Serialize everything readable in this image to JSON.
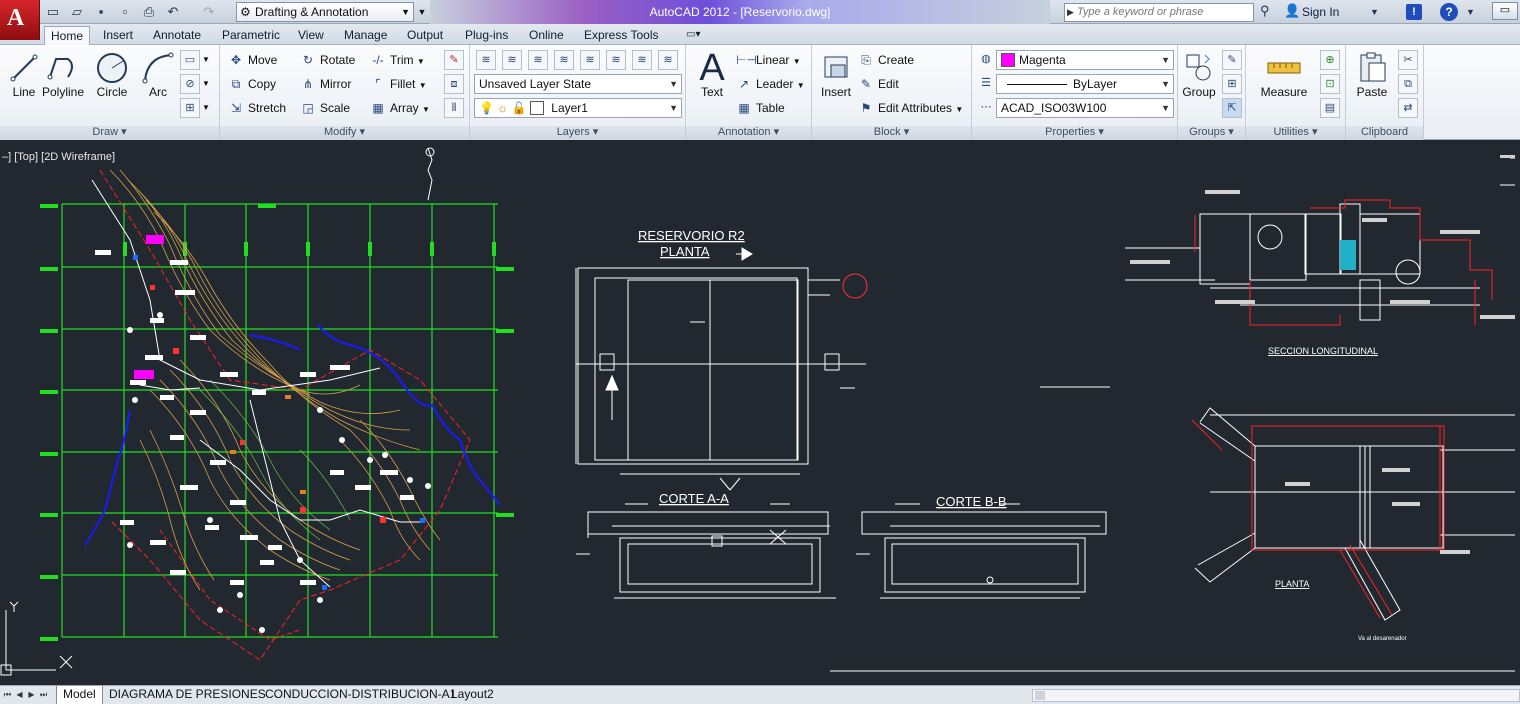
{
  "app": {
    "title": "AutoCAD 2012 - [Reservorio.dwg]",
    "workspace": "Drafting & Annotation",
    "search_placeholder": "Type a keyword or phrase",
    "sign_in": "Sign In"
  },
  "ribbon_tabs": [
    "Home",
    "Insert",
    "Annotate",
    "Parametric",
    "View",
    "Manage",
    "Output",
    "Plug-ins",
    "Online",
    "Express Tools"
  ],
  "panels": {
    "draw": {
      "title": "Draw",
      "line": "Line",
      "polyline": "Polyline",
      "circle": "Circle",
      "arc": "Arc"
    },
    "modify": {
      "title": "Modify",
      "move": "Move",
      "rotate": "Rotate",
      "trim": "Trim",
      "copy": "Copy",
      "mirror": "Mirror",
      "fillet": "Fillet",
      "stretch": "Stretch",
      "scale": "Scale",
      "array": "Array"
    },
    "layers": {
      "title": "Layers",
      "layer_state": "Unsaved Layer State",
      "current_layer": "Layer1"
    },
    "annotation": {
      "title": "Annotation",
      "text": "Text",
      "linear": "Linear",
      "leader": "Leader",
      "table": "Table"
    },
    "block": {
      "title": "Block",
      "insert": "Insert",
      "create": "Create",
      "edit": "Edit",
      "edit_attributes": "Edit Attributes"
    },
    "properties": {
      "title": "Properties",
      "color": "Magenta",
      "color_hex": "#ff00ff",
      "lineweight": "ByLayer",
      "linetype": "ACAD_ISO03W100"
    },
    "groups": {
      "title": "Groups",
      "group": "Group"
    },
    "utilities": {
      "title": "Utilities",
      "measure": "Measure"
    },
    "clipboard": {
      "title": "Clipboard",
      "paste": "Paste"
    }
  },
  "viewport": {
    "label": "–] [Top] [2D Wireframe]"
  },
  "drawing_labels": {
    "reservorio_title": "RESERVORIO R2",
    "planta_title": "PLANTA",
    "corte_aa": "CORTE A-A",
    "corte_bb": "CORTE B-B",
    "seccion": "SECCION LONGITUDINAL",
    "planta_right": "PLANTA",
    "desarenador": "Va al desarenador"
  },
  "layout_tabs": [
    "Model",
    "DIAGRAMA DE PRESIONES",
    "CONDUCCION-DISTRIBUCION-A1",
    "Layout2"
  ],
  "colors": {
    "background": "#212830",
    "grid": "#22dd22",
    "contour": "#d9a047",
    "river": "#1a1aff",
    "boundary": "#ff2020",
    "linework": "#ffffff"
  }
}
